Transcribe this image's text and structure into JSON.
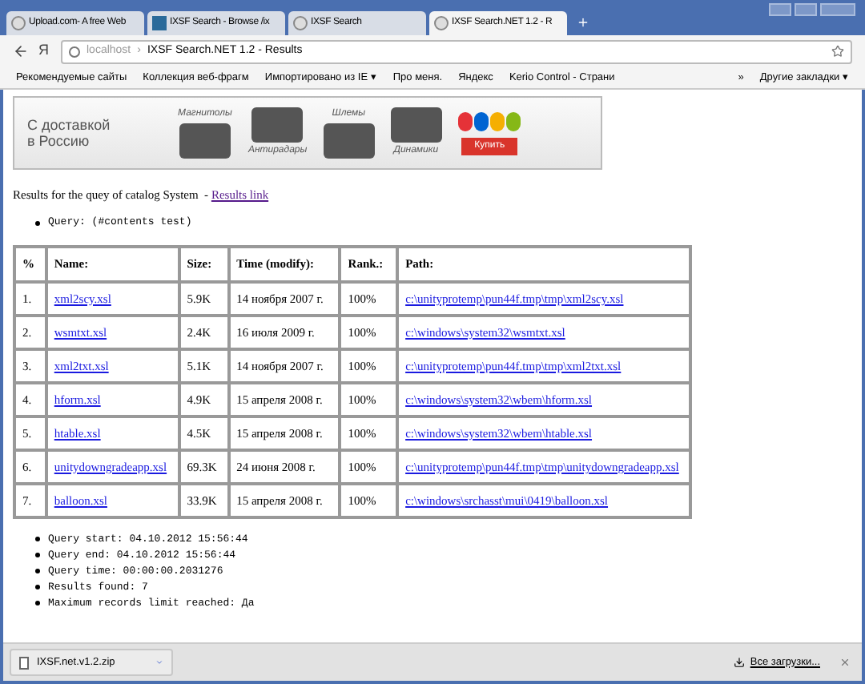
{
  "tabs": [
    {
      "label": "Upload.com- A free Web",
      "selected": false,
      "kind": "globe"
    },
    {
      "label": "IXSF Search - Browse /ix",
      "selected": false,
      "kind": "app"
    },
    {
      "label": "IXSF Search",
      "selected": false,
      "kind": "globe"
    },
    {
      "label": "IXSF Search.NET 1.2 - R",
      "selected": true,
      "kind": "globe"
    }
  ],
  "address": {
    "yandex": "Я",
    "host": "localhost",
    "separator": "›",
    "title": "IXSF Search.NET 1.2 - Results"
  },
  "bookmarks": [
    "Рекомендуемые сайты",
    "Коллекция веб-фрагм",
    "Импортировано из IE ▾",
    "Про меня.",
    "Яндекс",
    "Kerio Control - Страни"
  ],
  "bookmarks_more": "»",
  "other_bookmarks": "Другие закладки ▾",
  "banner": {
    "headline": "С доставкой\nв Россию",
    "labels": [
      "Магнитолы",
      "Антирадары",
      "Шлемы",
      "Динамики"
    ],
    "cta": "Купить"
  },
  "intro": {
    "text": "Results for the quey of catalog System  - ",
    "link": "Results link"
  },
  "query": "Query: (#contents test)",
  "table": {
    "columns": [
      "%",
      "Name:",
      "Size:",
      "Time (modify):",
      "Rank.:",
      "Path:"
    ],
    "rows": [
      [
        "1.",
        "xml2scy.xsl",
        "5.9K",
        "14 ноября 2007 г.",
        "100%",
        "c:\\unityprotemp\\pun44f.tmp\\tmp\\xml2scy.xsl"
      ],
      [
        "2.",
        "wsmtxt.xsl",
        "2.4K",
        "16 июля 2009 г.",
        "100%",
        "c:\\windows\\system32\\wsmtxt.xsl"
      ],
      [
        "3.",
        "xml2txt.xsl",
        "5.1K",
        "14 ноября 2007 г.",
        "100%",
        "c:\\unityprotemp\\pun44f.tmp\\tmp\\xml2txt.xsl"
      ],
      [
        "4.",
        "hform.xsl",
        "4.9K",
        "15 апреля 2008 г.",
        "100%",
        "c:\\windows\\system32\\wbem\\hform.xsl"
      ],
      [
        "5.",
        "htable.xsl",
        "4.5K",
        "15 апреля 2008 г.",
        "100%",
        "c:\\windows\\system32\\wbem\\htable.xsl"
      ],
      [
        "6.",
        "unitydowngradeapp.xsl",
        "69.3K",
        "24 июня 2008 г.",
        "100%",
        "c:\\unityprotemp\\pun44f.tmp\\tmp\\unitydowngradeapp.xsl"
      ],
      [
        "7.",
        "balloon.xsl",
        "33.9K",
        "15 апреля 2008 г.",
        "100%",
        "c:\\windows\\srchasst\\mui\\0419\\balloon.xsl"
      ]
    ]
  },
  "stats": [
    "Query start: 04.10.2012 15:56:44",
    "Query end: 04.10.2012 15:56:44",
    "Query time: 00:00:00.2031276",
    "Results found: 7",
    "Maximum records limit reached: Да"
  ],
  "download": {
    "file": "IXSF.net.v1.2.zip",
    "all": "Все загрузки..."
  }
}
